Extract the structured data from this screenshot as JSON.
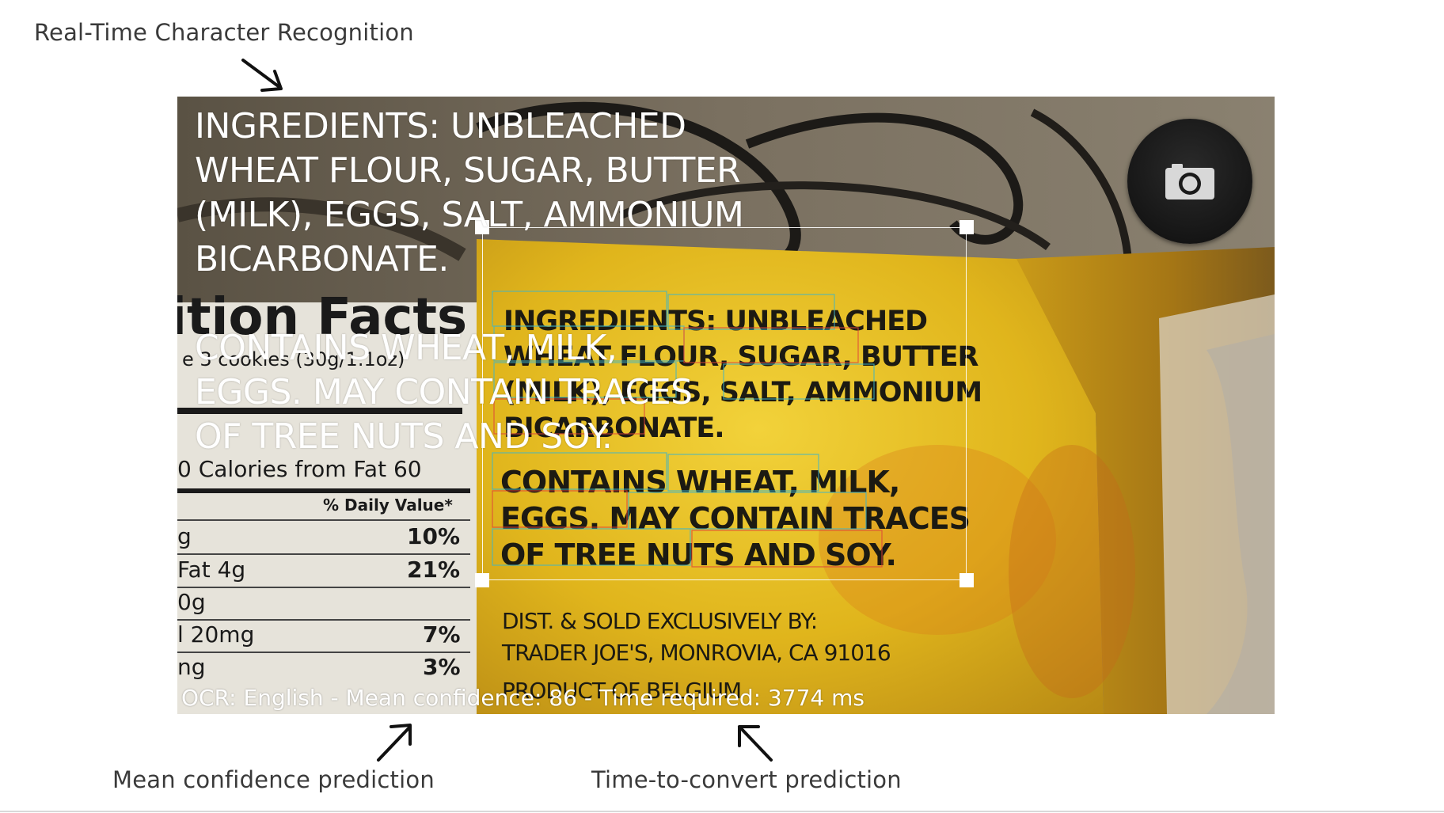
{
  "annotations": {
    "top_label": "Real-Time Character Recognition",
    "confidence_label": "Mean confidence prediction",
    "time_label": "Time-to-convert prediction"
  },
  "preview": {
    "ocr_result_paragraphs": [
      "INGREDIENTS: UNBLEACHED\nWHEAT FLOUR, SUGAR, BUTTER\n(MILK), EGGS, SALT, AMMONIUM\nBICARBONATE.",
      "CONTAINS WHEAT, MILK,\nEGGS. MAY CONTAIN TRACES\nOF TREE NUTS AND SOY."
    ],
    "status_text": "OCR: English - Mean confidence: 86 - Time required: 3774 ms",
    "camera_icon": "camera-icon",
    "photo_label_text": {
      "ingredients_lines": [
        "INGREDIENTS: UNBLEACHED",
        "WHEAT FLOUR, SUGAR, BUTTER",
        "(MILK), EGGS, SALT, AMMONIUM",
        "BICARBONATE."
      ],
      "contains_lines": [
        "CONTAINS WHEAT, MILK,",
        "EGGS. MAY CONTAIN TRACES",
        "OF TREE NUTS AND SOY."
      ],
      "dist_lines": [
        "DIST. & SOLD EXCLUSIVELY BY:",
        "TRADER JOE'S, MONROVIA, CA 91016"
      ],
      "product_of": "PRODUCT OF BELGIUM",
      "nutrition_title": "ition Facts",
      "nutrition_rows": [
        {
          "label": "e 3 cookies (30g/1.1oz)",
          "value": ""
        },
        {
          "label": "0     Calories from Fat 60",
          "value": ""
        },
        {
          "label": "% Daily Value*",
          "value": ""
        },
        {
          "label": "g",
          "value": "10%"
        },
        {
          "label": " Fat 4g",
          "value": "21%"
        },
        {
          "label": "0g",
          "value": ""
        },
        {
          "label": "l 20mg",
          "value": "7%"
        },
        {
          "label": "ng",
          "value": "3%"
        }
      ]
    }
  },
  "colors": {
    "annotation_text": "#3a3a3a",
    "label_yellow": "#e8c21e",
    "overlay_text": "#ffffff"
  }
}
